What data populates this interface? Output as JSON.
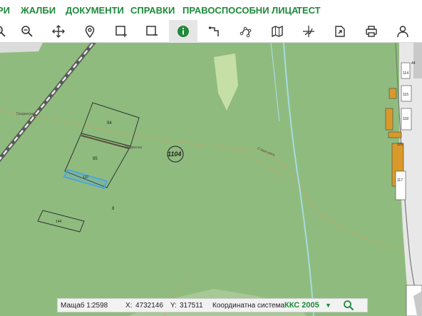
{
  "nav": {
    "items": [
      {
        "label": "РИ"
      },
      {
        "label": "ЖАЛБИ"
      },
      {
        "label": "ДОКУМЕНТИ"
      },
      {
        "label": "СПРАВКИ"
      },
      {
        "label": "ПРАВОСПОСОБНИ ЛИЦА"
      },
      {
        "label": "ТЕСТ"
      }
    ],
    "color": "#1e8a3a"
  },
  "toolbar": {
    "tools": [
      {
        "icon": "zoom-in-icon"
      },
      {
        "icon": "zoom-out-icon"
      },
      {
        "icon": "pan-icon"
      },
      {
        "icon": "location-pin-icon"
      },
      {
        "icon": "select-rectangle-icon"
      },
      {
        "icon": "deselect-rectangle-icon"
      },
      {
        "icon": "info-icon",
        "active": true
      },
      {
        "icon": "measure-distance-icon"
      },
      {
        "icon": "measure-area-icon"
      },
      {
        "icon": "map-layers-icon"
      },
      {
        "icon": "coordinates-icon"
      },
      {
        "icon": "export-icon"
      },
      {
        "icon": "print-icon"
      },
      {
        "icon": "user-icon"
      }
    ]
  },
  "map": {
    "parcels": [
      {
        "label": "94"
      },
      {
        "label": "95"
      },
      {
        "label": "137"
      },
      {
        "label": "144"
      },
      {
        "label": "8"
      }
    ],
    "area_label": "1104",
    "road_labels": [
      "Градинска",
      "Градинска",
      "Стара река"
    ],
    "building_labels": [
      "114",
      "115",
      "118",
      "121",
      "117",
      "44"
    ],
    "colors": {
      "land": "#8fbc7e",
      "path": "#c8a26a",
      "building": "#d99a2b",
      "selected": "#4aa3df"
    }
  },
  "status": {
    "scale_label": "Мащаб 1:",
    "scale_value": "2598",
    "x_label": "X:",
    "x_value": "4732146",
    "y_label": "Y:",
    "y_value": "317511",
    "crs_label": "Координатна система:",
    "crs_value": "ККС 2005"
  }
}
